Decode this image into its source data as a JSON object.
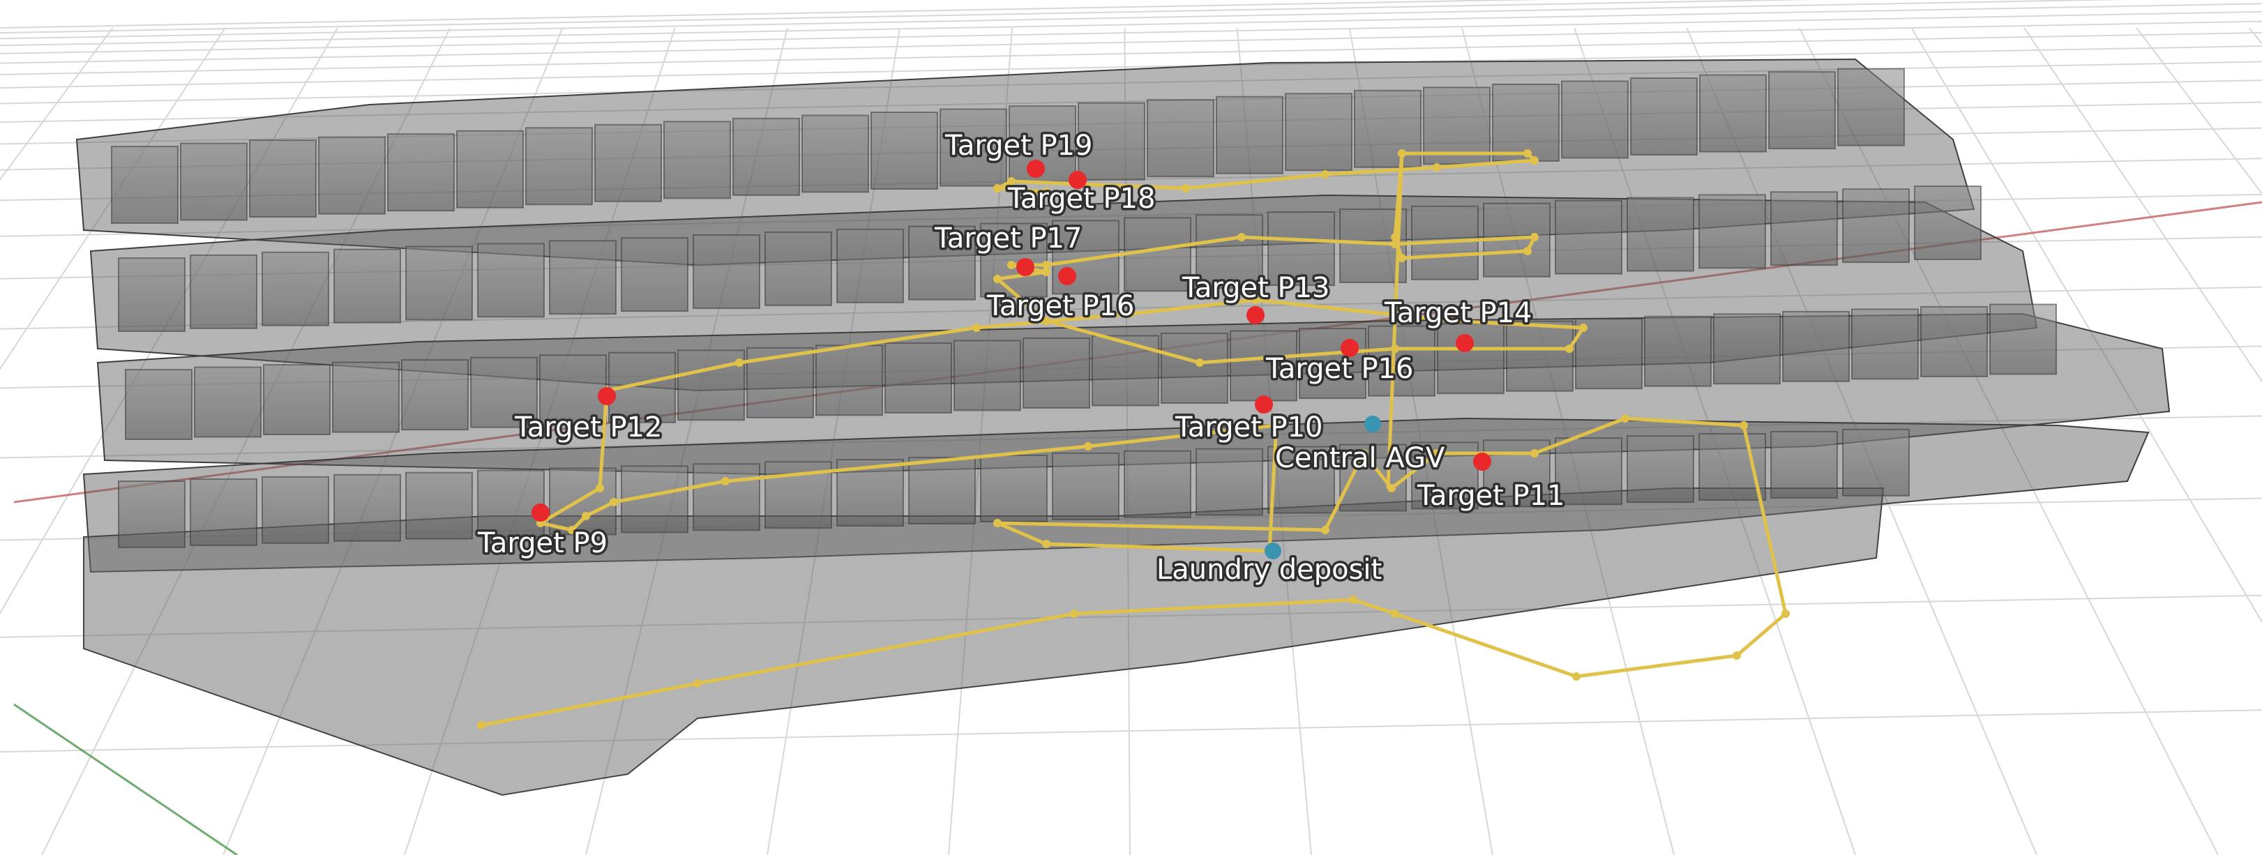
{
  "colors": {
    "target": "#e8282a",
    "station": "#3a93b0",
    "route": "#e0c24a",
    "building": "#6d6d6d",
    "grid": "#d7d7d7",
    "x_axis": "#c76060",
    "y_axis": "#5fa35f"
  },
  "targets": [
    {
      "id": "p19",
      "label": "Target P19"
    },
    {
      "id": "p18",
      "label": "Target P18"
    },
    {
      "id": "p17",
      "label": "Target P17"
    },
    {
      "id": "p16a",
      "label": "Target P16"
    },
    {
      "id": "p13",
      "label": "Target P13"
    },
    {
      "id": "p14",
      "label": "Target P14"
    },
    {
      "id": "p16b",
      "label": "Target P16"
    },
    {
      "id": "p12",
      "label": "Target P12"
    },
    {
      "id": "p10",
      "label": "Target P10"
    },
    {
      "id": "p11",
      "label": "Target P11"
    },
    {
      "id": "p9",
      "label": "Target P9"
    }
  ],
  "stations": [
    {
      "id": "central",
      "label": "Central AGV"
    },
    {
      "id": "laundry",
      "label": "Laundry deposit"
    }
  ]
}
